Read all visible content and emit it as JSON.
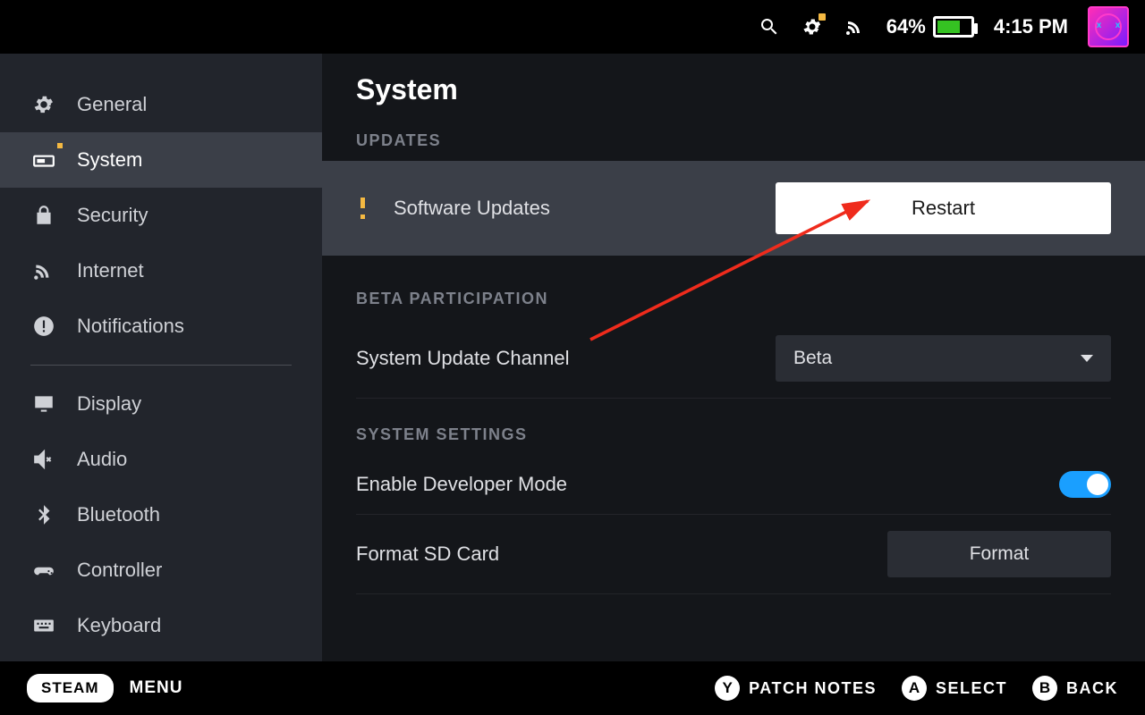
{
  "topbar": {
    "battery_percent": "64%",
    "battery_fill_pct": 64,
    "time": "4:15 PM"
  },
  "sidebar": {
    "items": [
      {
        "label": "General"
      },
      {
        "label": "System"
      },
      {
        "label": "Security"
      },
      {
        "label": "Internet"
      },
      {
        "label": "Notifications"
      },
      {
        "label": "Display"
      },
      {
        "label": "Audio"
      },
      {
        "label": "Bluetooth"
      },
      {
        "label": "Controller"
      },
      {
        "label": "Keyboard"
      }
    ]
  },
  "page": {
    "title": "System",
    "sections": {
      "updates_header": "UPDATES",
      "software_updates_label": "Software Updates",
      "restart_label": "Restart",
      "beta_header": "BETA PARTICIPATION",
      "channel_label": "System Update Channel",
      "channel_value": "Beta",
      "settings_header": "SYSTEM SETTINGS",
      "devmode_label": "Enable Developer Mode",
      "format_label": "Format SD Card",
      "format_button": "Format"
    }
  },
  "footer": {
    "steam": "STEAM",
    "menu": "MENU",
    "hints": [
      {
        "key": "Y",
        "label": "PATCH NOTES"
      },
      {
        "key": "A",
        "label": "SELECT"
      },
      {
        "key": "B",
        "label": "BACK"
      }
    ]
  }
}
